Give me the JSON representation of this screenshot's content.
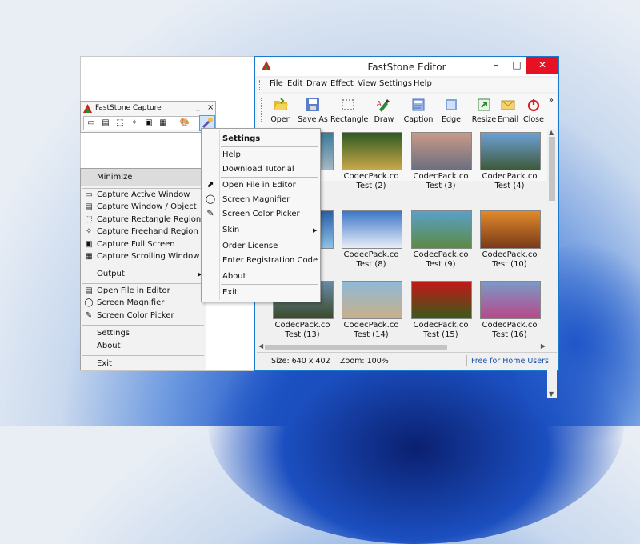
{
  "editor": {
    "title": "FastStone Editor",
    "menu": [
      "File",
      "Edit",
      "Draw",
      "Effect",
      "View",
      "Settings",
      "Help"
    ],
    "toolbar": [
      {
        "label": "Open",
        "icon": "folder-open-icon"
      },
      {
        "label": "Save As",
        "icon": "floppy-icon"
      },
      {
        "label": "Rectangle",
        "icon": "rectangle-select-icon"
      },
      {
        "label": "Draw",
        "icon": "draw-icon"
      },
      {
        "label": "Caption",
        "icon": "caption-icon"
      },
      {
        "label": "Edge",
        "icon": "edge-icon"
      },
      {
        "label": "Resize",
        "icon": "resize-icon"
      },
      {
        "label": "Email",
        "icon": "email-icon"
      },
      {
        "label": "Close",
        "icon": "power-icon"
      }
    ],
    "more": "»",
    "thumbnails": [
      {
        "line1": "",
        "line2": "",
        "colors": [
          "#3b7a9a",
          "#a6b8c4"
        ]
      },
      {
        "line1": "CodecPack.co",
        "line2": "Test  (2)",
        "colors": [
          "#2e5a22",
          "#c8a84a"
        ]
      },
      {
        "line1": "CodecPack.co",
        "line2": "Test  (3)",
        "colors": [
          "#c89a88",
          "#6c6f80"
        ]
      },
      {
        "line1": "CodecPack.co",
        "line2": "Test  (4)",
        "colors": [
          "#6da0d6",
          "#3e5a3a"
        ]
      },
      {
        "line1": "",
        "line2": "",
        "colors": [
          "#2a5fa8",
          "#8fc1e6"
        ]
      },
      {
        "line1": "CodecPack.co",
        "line2": "Test  (8)",
        "colors": [
          "#3c77c9",
          "#e8eef6"
        ]
      },
      {
        "line1": "CodecPack.co",
        "line2": "Test  (9)",
        "colors": [
          "#5aa0c8",
          "#5d8a45"
        ]
      },
      {
        "line1": "CodecPack.co",
        "line2": "Test  (10)",
        "colors": [
          "#e08a2a",
          "#7a3a1a"
        ]
      },
      {
        "line1": "CodecPack.co",
        "line2": "Test  (13)",
        "colors": [
          "#6a8aa6",
          "#3a4a2a"
        ]
      },
      {
        "line1": "CodecPack.co",
        "line2": "Test  (14)",
        "colors": [
          "#8fb8d8",
          "#c8b08a"
        ]
      },
      {
        "line1": "CodecPack.co",
        "line2": "Test  (15)",
        "colors": [
          "#c21818",
          "#3a5a1a"
        ]
      },
      {
        "line1": "CodecPack.co",
        "line2": "Test  (16)",
        "colors": [
          "#7a9ac8",
          "#b8488a"
        ]
      }
    ],
    "status": {
      "size": "Size: 640 x 402",
      "zoom": "Zoom: 100%",
      "free": "Free for Home Users"
    }
  },
  "capture": {
    "title": "FastStone Capture",
    "minimize": "_",
    "close": "×"
  },
  "context_menu": {
    "minimize": "Minimize",
    "items": [
      "Capture Active Window",
      "Capture Window / Object",
      "Capture Rectangle Region",
      "Capture Freehand Region",
      "Capture Full Screen",
      "Capture Scrolling Window"
    ],
    "output": "Output",
    "tools": [
      "Open File in Editor",
      "Screen Magnifier",
      "Screen Color Picker"
    ],
    "settings": "Settings",
    "about": "About",
    "exit": "Exit"
  },
  "settings_menu": {
    "settings": "Settings",
    "help": "Help",
    "download": "Download Tutorial",
    "open_editor": "Open File in Editor",
    "magnifier": "Screen Magnifier",
    "color_picker": "Screen Color Picker",
    "skin": "Skin",
    "order": "Order License",
    "register": "Enter Registration Code",
    "about": "About",
    "exit": "Exit"
  },
  "colors": {
    "accent": "#1979ca",
    "close_red": "#e81123",
    "free_link": "#1a4fa8"
  }
}
